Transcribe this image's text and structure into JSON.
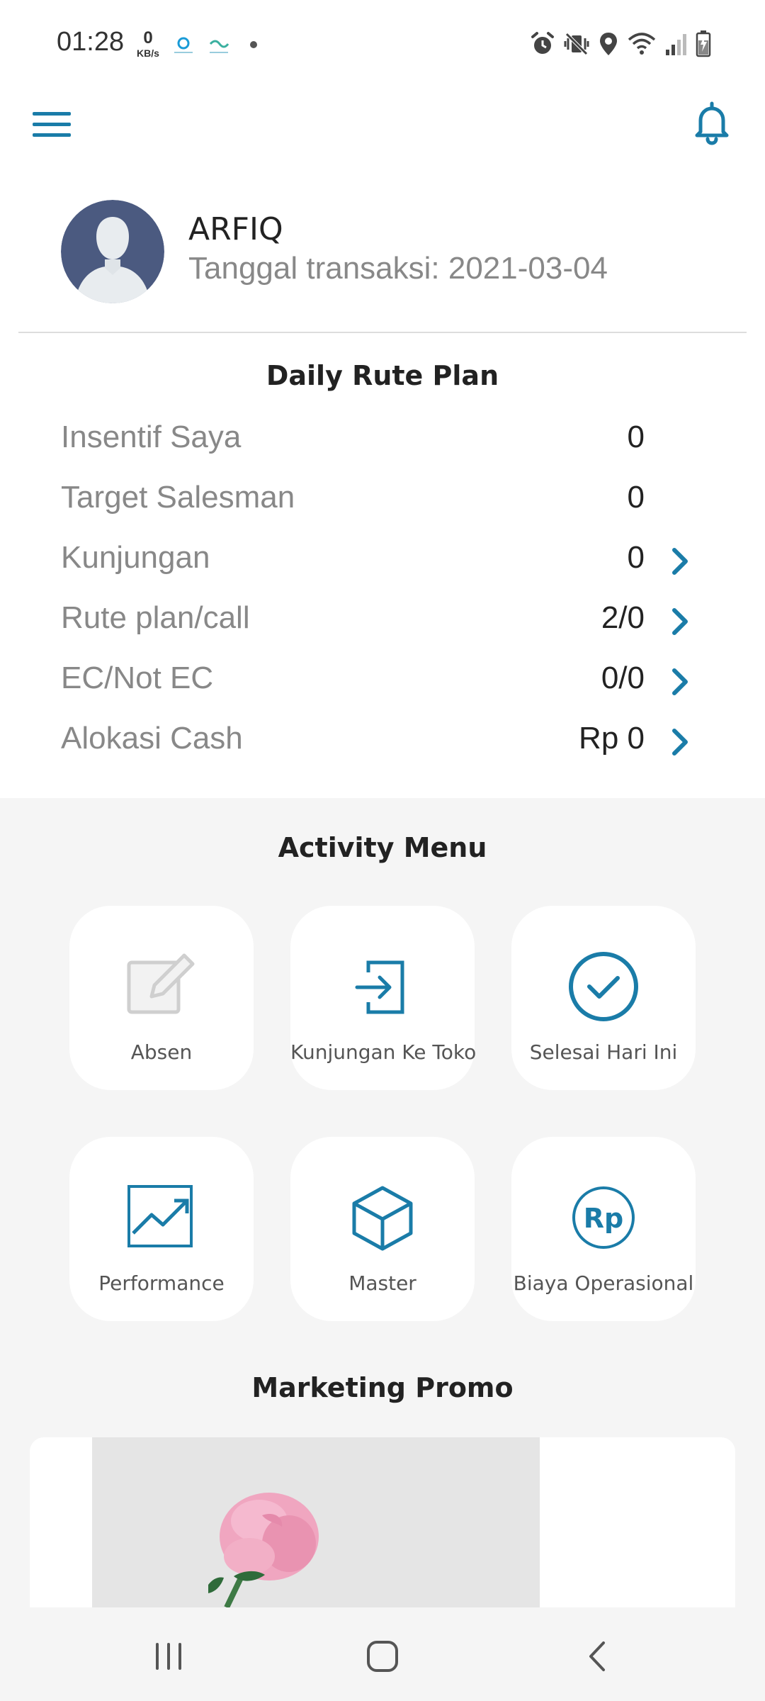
{
  "status_bar": {
    "time": "01:28",
    "speed_value": "0",
    "speed_unit": "KB/s",
    "icons": [
      "alarm-icon",
      "vibrate-mute-icon",
      "location-icon",
      "wifi-icon",
      "signal-icon",
      "battery-charging-icon"
    ]
  },
  "appbar": {
    "menu_icon": "hamburger-menu-icon",
    "notification_icon": "bell-icon",
    "accent_color": "#1a7ca8"
  },
  "profile": {
    "name": "ARFIQ",
    "transaction_date": "Tanggal transaksi: 2021-03-04"
  },
  "daily_plan": {
    "title": "Daily Rute Plan",
    "rows": [
      {
        "label": "Insentif Saya",
        "value": "0",
        "has_arrow": false
      },
      {
        "label": "Target Salesman",
        "value": "0",
        "has_arrow": false
      },
      {
        "label": "Kunjungan",
        "value": "0",
        "has_arrow": true
      },
      {
        "label": "Rute plan/call",
        "value": "2/0",
        "has_arrow": true
      },
      {
        "label": "EC/Not EC",
        "value": "0/0",
        "has_arrow": true
      },
      {
        "label": "Alokasi Cash",
        "value": "Rp 0",
        "has_arrow": true
      }
    ]
  },
  "activity_menu": {
    "title": "Activity Menu",
    "items": [
      {
        "label": "Absen",
        "icon": "edit-icon",
        "enabled": false
      },
      {
        "label": "Kunjungan Ke Toko",
        "icon": "sign-in-icon",
        "enabled": true
      },
      {
        "label": "Selesai Hari Ini",
        "icon": "check-circle-icon",
        "enabled": true
      },
      {
        "label": "Performance",
        "icon": "chart-trend-icon",
        "enabled": true
      },
      {
        "label": "Master",
        "icon": "cube-icon",
        "enabled": true
      },
      {
        "label": "Biaya Operasional",
        "icon": "rupiah-icon",
        "enabled": true
      }
    ],
    "rp_symbol": "Rp"
  },
  "marketing_promo": {
    "title": "Marketing Promo"
  },
  "nav_bar": {
    "buttons": [
      "recent-apps-icon",
      "home-icon",
      "back-icon"
    ]
  }
}
